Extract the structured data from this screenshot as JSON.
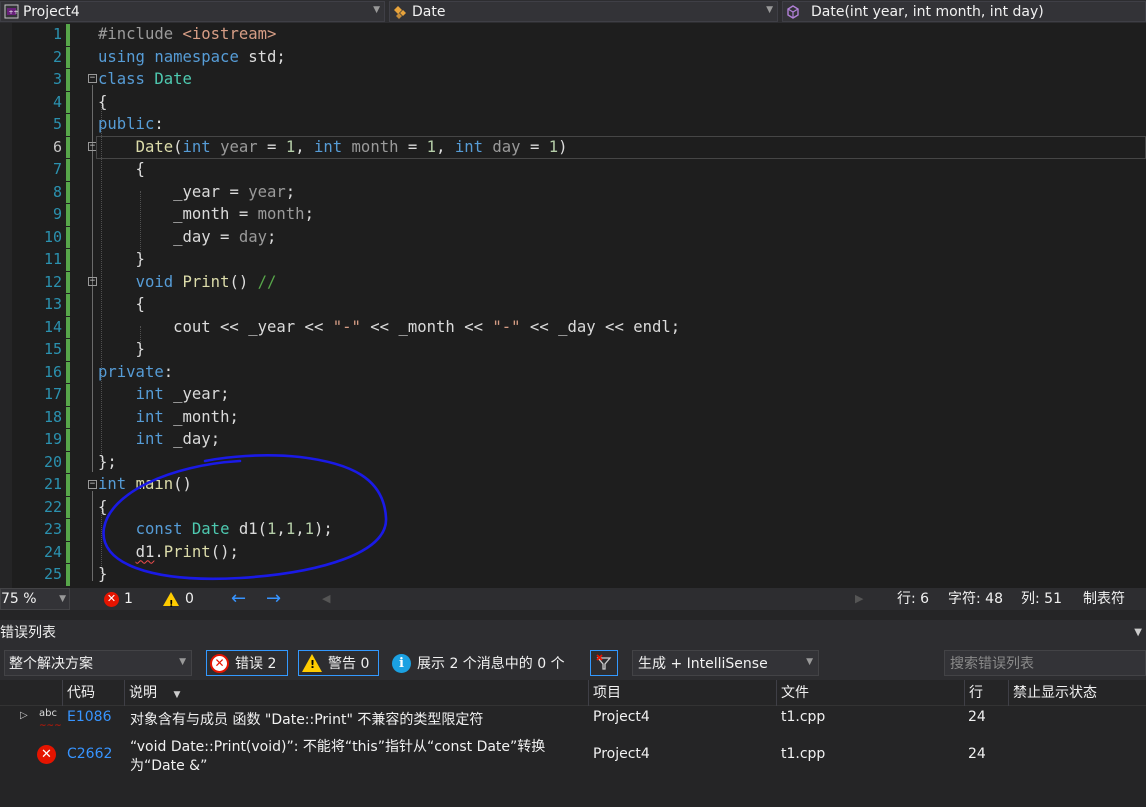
{
  "navbar": {
    "project": "Project4",
    "class": "Date",
    "member": "Date(int year, int month, int day)"
  },
  "editor": {
    "line_numbers": [
      "1",
      "2",
      "3",
      "4",
      "5",
      "6",
      "7",
      "8",
      "9",
      "10",
      "11",
      "12",
      "13",
      "14",
      "15",
      "16",
      "17",
      "18",
      "19",
      "20",
      "21",
      "22",
      "23",
      "24",
      "25"
    ],
    "current_line": 6,
    "annotation_color": "#1a1ae6"
  },
  "status": {
    "zoom": "75 %",
    "errors": "1",
    "warnings": "0",
    "row": "行: 6",
    "col_chars": "字符: 48",
    "col": "列: 51",
    "tab": "制表符"
  },
  "error_list": {
    "title": "错误列表",
    "scope": "整个解决方案",
    "errors_btn": "错误 2",
    "warnings_btn": "警告 0",
    "messages": "展示 2 个消息中的 0 个",
    "build_filter": "生成 + IntelliSense",
    "search_placeholder": "搜索错误列表",
    "columns": {
      "code": "代码",
      "desc": "说明",
      "project": "项目",
      "file": "文件",
      "line": "行",
      "suppress": "禁止显示状态"
    },
    "rows": [
      {
        "code": "E1086",
        "desc": "对象含有与成员 函数 \"Date::Print\" 不兼容的类型限定符",
        "desc2": "",
        "project": "Project4",
        "file": "t1.cpp",
        "line": "24",
        "icon": "intellisense-error-icon"
      },
      {
        "code": "C2662",
        "desc": "“void Date::Print(void)”: 不能将“this”指针从“const Date”转换",
        "desc2": "为“Date &”",
        "project": "Project4",
        "file": "t1.cpp",
        "line": "24",
        "icon": "error-icon"
      }
    ]
  }
}
